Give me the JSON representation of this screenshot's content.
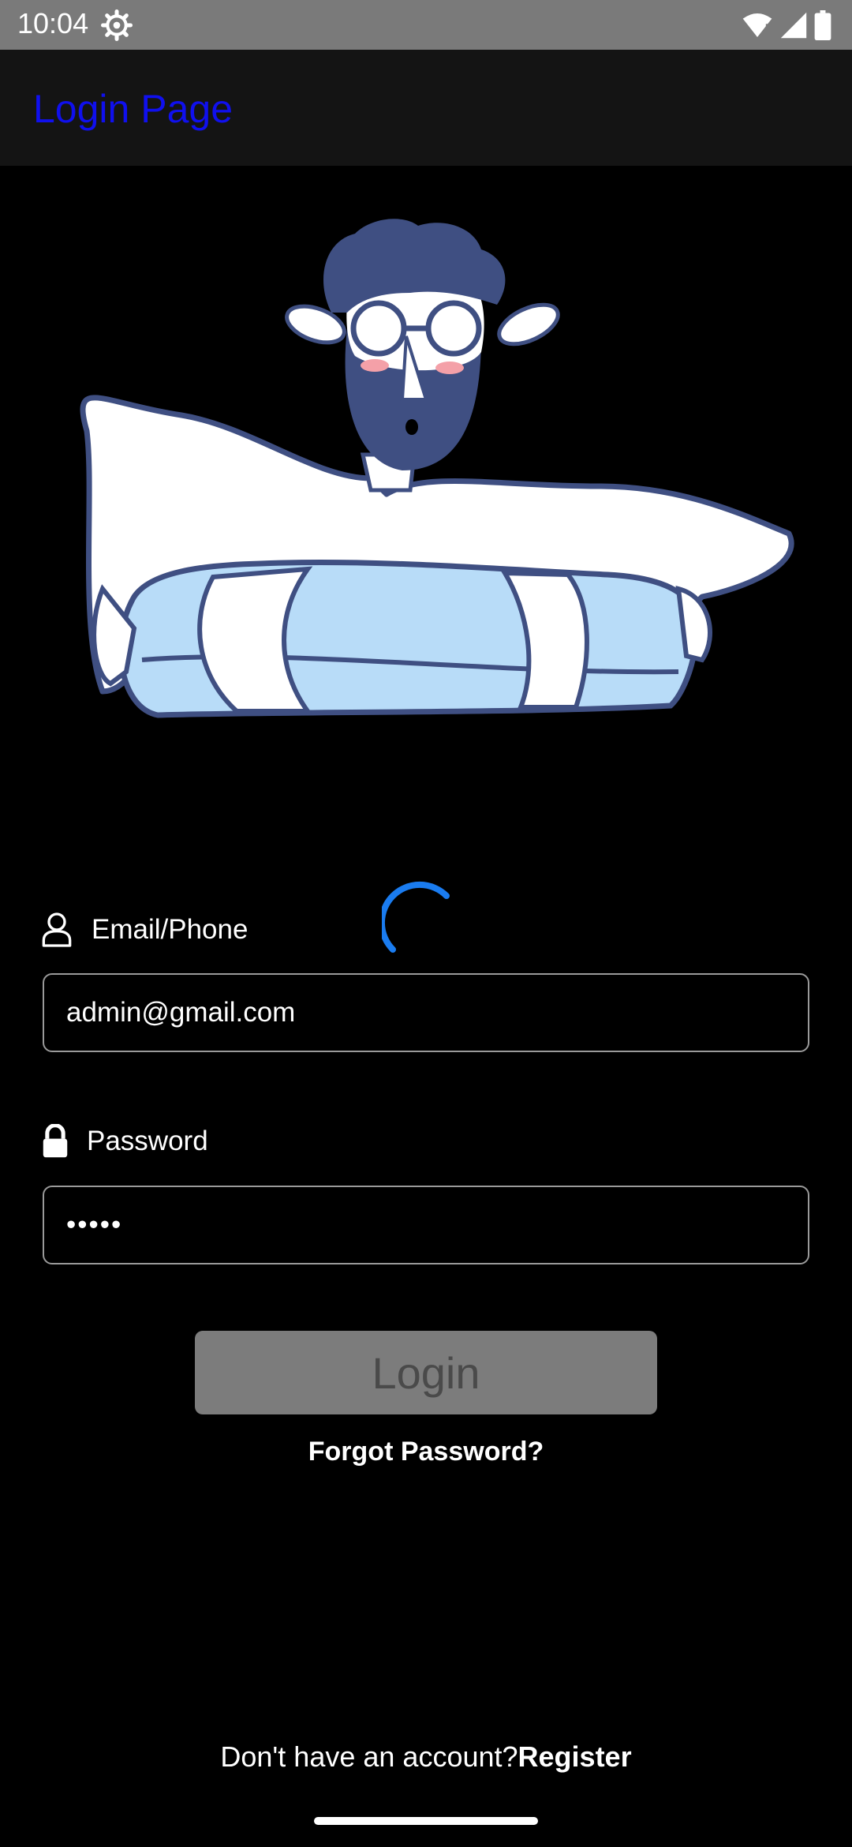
{
  "status_bar": {
    "time": "10:04",
    "icons": [
      "settings-gear-icon",
      "wifi-icon",
      "cellular-signal-icon",
      "battery-icon"
    ]
  },
  "app_bar": {
    "title": "Login Page",
    "title_color": "#1010ee"
  },
  "hero_image": {
    "icon": "illustration-man-in-swim-ring"
  },
  "loading": {
    "spinner_color": "#1a7cf0"
  },
  "form": {
    "email": {
      "label": "Email/Phone",
      "icon": "user-icon",
      "value": "admin@gmail.com"
    },
    "password": {
      "label": "Password",
      "icon": "lock-icon",
      "value": "•••••"
    },
    "login_button": {
      "label": "Login",
      "state": "disabled"
    },
    "forgot_password": "Forgot Password?"
  },
  "footer": {
    "prompt": "Don't have an account?",
    "register_link": "Register"
  }
}
